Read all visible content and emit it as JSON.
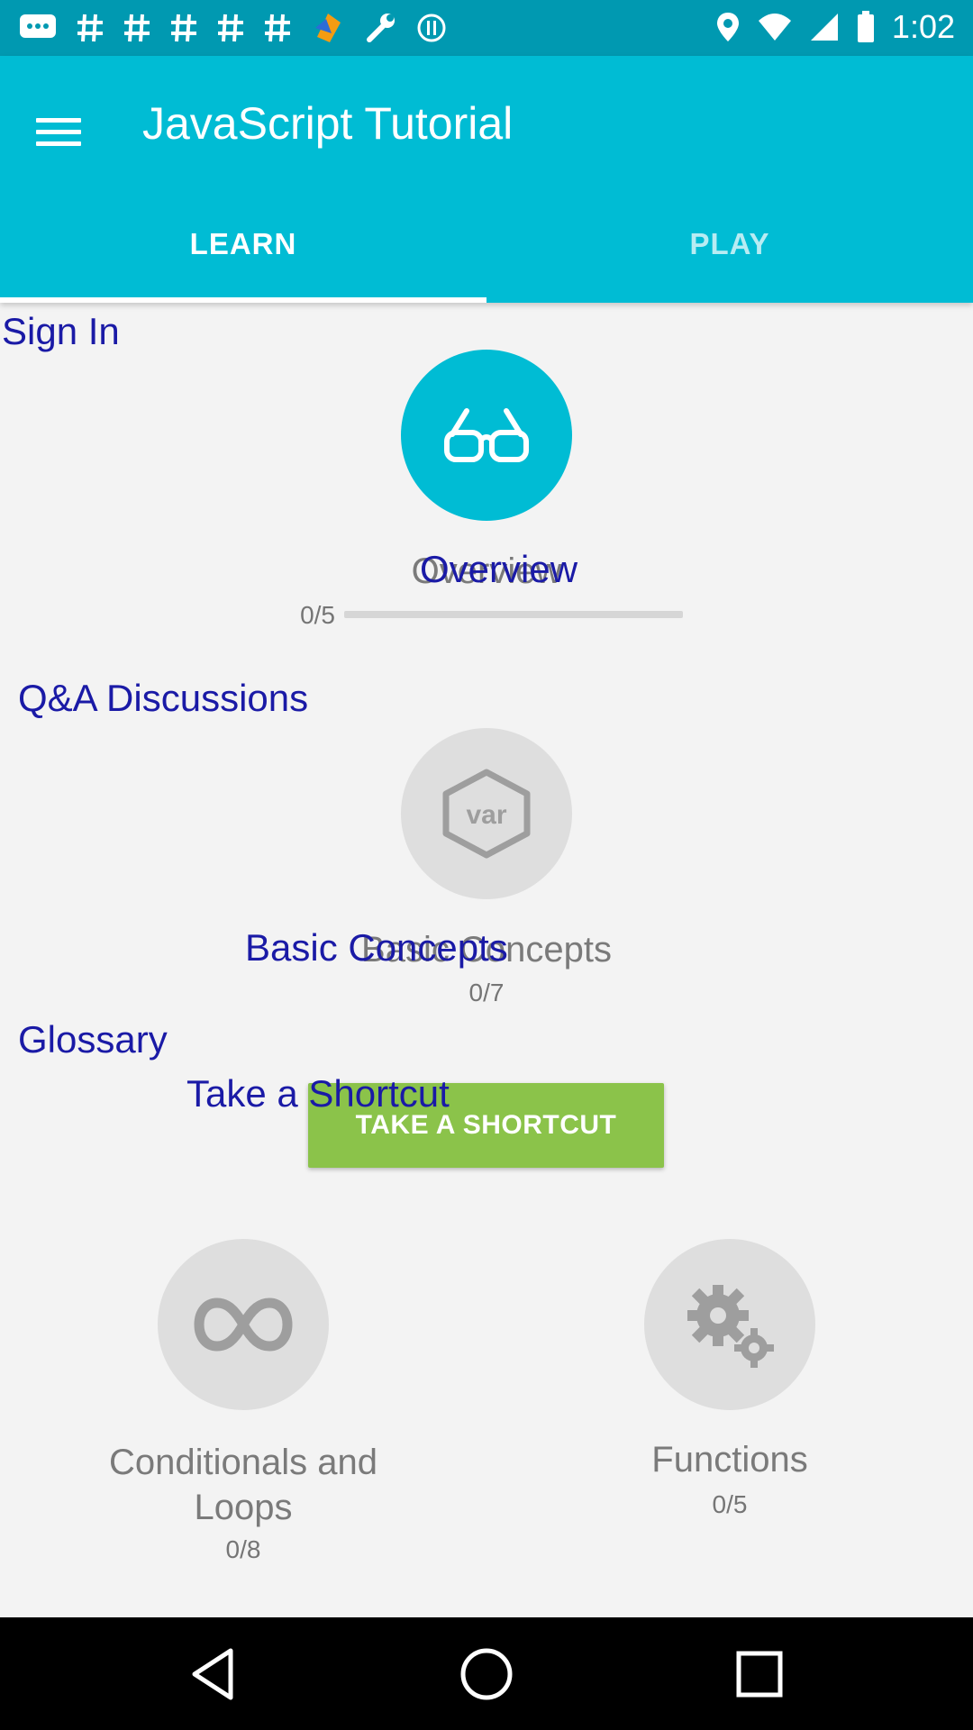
{
  "status_bar": {
    "time": "1:02",
    "icons_left": [
      "chat-icon",
      "hashtag-icon",
      "hashtag-icon",
      "hashtag-icon",
      "hashtag-icon",
      "hashtag-icon",
      "app-logo-icon",
      "wrench-icon",
      "info-icon"
    ],
    "icons_right": [
      "location-icon",
      "wifi-icon",
      "signal-icon",
      "battery-icon"
    ]
  },
  "app_bar": {
    "title": "JavaScript Tutorial",
    "menu_icon": "hamburger-menu-icon"
  },
  "tabs": [
    {
      "label": "LEARN",
      "selected": true
    },
    {
      "label": "PLAY",
      "selected": false
    }
  ],
  "links": {
    "sign_in": "Sign In",
    "overview": "Overview",
    "qa": "Q&A Discussions",
    "basic_concepts": "Basic Concepts",
    "glossary": "Glossary",
    "take_shortcut": "Take a Shortcut"
  },
  "lessons": {
    "overview": {
      "title": "Overview",
      "count": "0/5",
      "progress": 0.0,
      "icon": "glasses-icon"
    },
    "basic_concepts": {
      "title": "Basic Concepts",
      "count": "0/7",
      "icon": "var-hexagon-icon",
      "icon_text": "var"
    },
    "conditionals": {
      "title_line1": "Conditionals and",
      "title_line2": "Loops",
      "count": "0/8",
      "icon": "infinity-icon"
    },
    "functions": {
      "title": "Functions",
      "count": "0/5",
      "icon": "gears-icon"
    }
  },
  "shortcut_button": {
    "label": "TAKE A SHORTCUT"
  },
  "colors": {
    "status_bar": "#0099b1",
    "app_bar": "#00bcd4",
    "link": "#1a1aa6",
    "shortcut": "#8bc34a",
    "inactive_circle": "#dedede"
  },
  "nav_bar": {
    "icons": [
      "back-icon",
      "home-icon",
      "recents-icon"
    ]
  }
}
